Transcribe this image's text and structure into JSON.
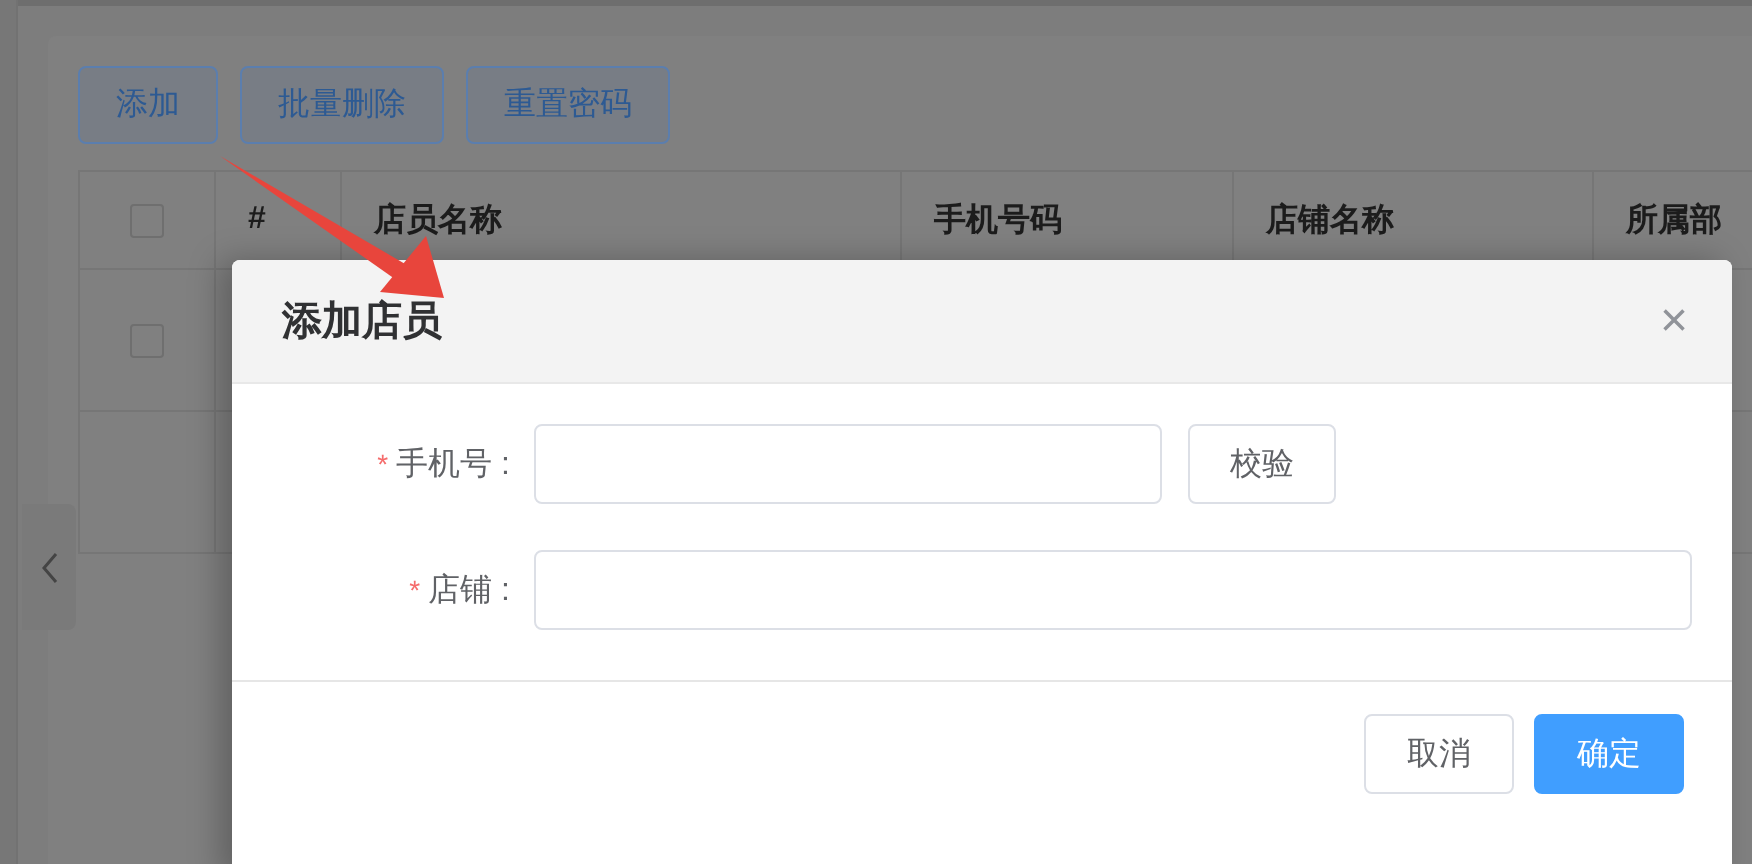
{
  "toolbar": {
    "buttons": [
      "添加",
      "批量删除",
      "重置密码"
    ]
  },
  "table": {
    "header_checkbox": {
      "checked": false
    },
    "columns": [
      "#",
      "店员名称",
      "手机号码",
      "店铺名称",
      "所属部"
    ],
    "rows": [
      {
        "checked": false
      }
    ]
  },
  "dialog": {
    "title": "添加店员",
    "close": "×",
    "fields": [
      {
        "kind": "with-button",
        "marker": "*",
        "label": "手机号 :",
        "button": "校验"
      },
      {
        "kind": "plain",
        "marker": "*",
        "label": "店铺 :"
      }
    ],
    "buttons": [
      {
        "label": "取消",
        "primary": false
      },
      {
        "label": "确定",
        "primary": true
      }
    ]
  }
}
